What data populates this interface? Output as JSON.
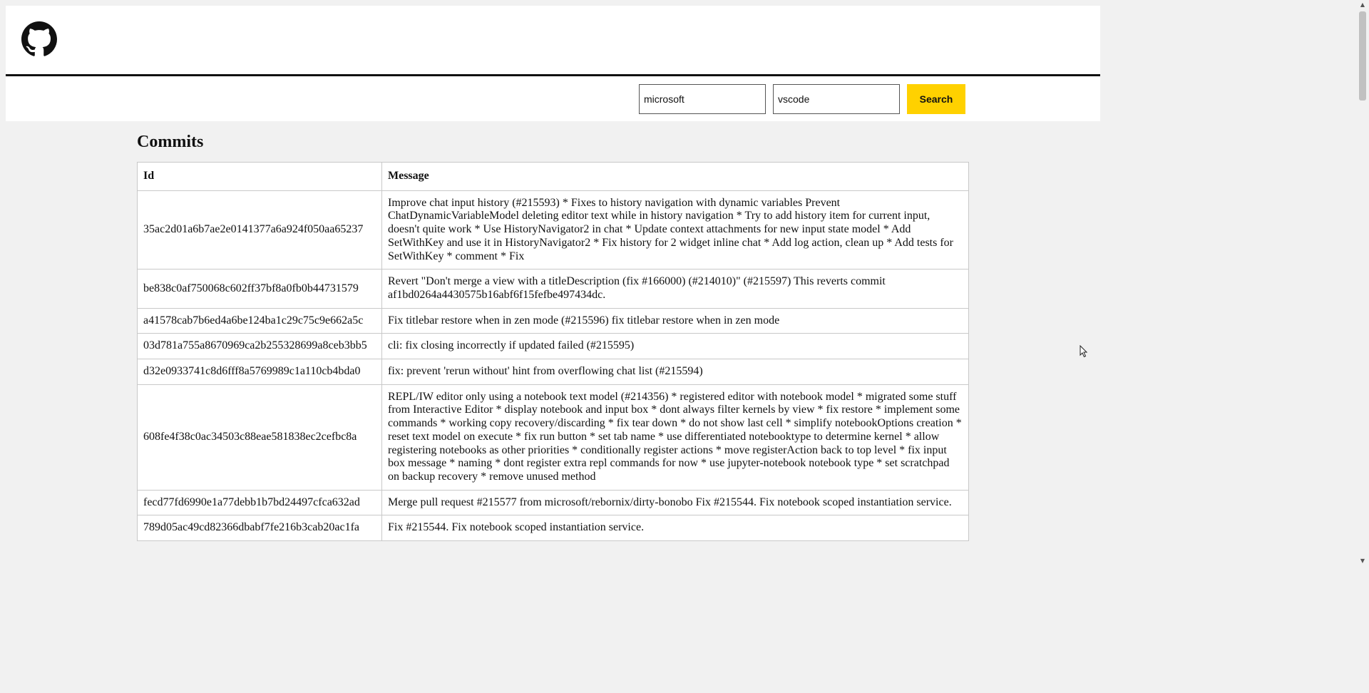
{
  "header": {
    "logo_icon": "github-icon",
    "owner_input": {
      "value": "microsoft"
    },
    "repo_input": {
      "value": "vscode"
    },
    "search_label": "Search",
    "accent_color": "#ffd100"
  },
  "main": {
    "title": "Commits",
    "columns": [
      "Id",
      "Message"
    ],
    "rows": [
      {
        "id": "35ac2d01a6b7ae2e0141377a6a924f050aa65237",
        "message": "Improve chat input history (#215593) * Fixes to history navigation with dynamic variables Prevent ChatDynamicVariableModel deleting editor text while in history navigation * Try to add history item for current input, doesn't quite work * Use HistoryNavigator2 in chat * Update context attachments for new input state model * Add SetWithKey and use it in HistoryNavigator2 * Fix history for 2 widget inline chat * Add log action, clean up * Add tests for SetWithKey * comment * Fix"
      },
      {
        "id": "be838c0af750068c602ff37bf8a0fb0b44731579",
        "message": "Revert \"Don't merge a view with a titleDescription (fix #166000) (#214010)\" (#215597) This reverts commit af1bd0264a4430575b16abf6f15fefbe497434dc."
      },
      {
        "id": "a41578cab7b6ed4a6be124ba1c29c75c9e662a5c",
        "message": "Fix titlebar restore when in zen mode (#215596) fix titlebar restore when in zen mode"
      },
      {
        "id": "03d781a755a8670969ca2b255328699a8ceb3bb5",
        "message": "cli: fix closing incorrectly if updated failed (#215595)"
      },
      {
        "id": "d32e0933741c8d6fff8a5769989c1a110cb4bda0",
        "message": "fix: prevent 'rerun without' hint from overflowing chat list (#215594)"
      },
      {
        "id": "608fe4f38c0ac34503c88eae581838ec2cefbc8a",
        "message": "REPL/IW editor only using a notebook text model (#214356) * registered editor with notebook model * migrated some stuff from Interactive Editor * display notebook and input box * dont always filter kernels by view * fix restore * implement some commands * working copy recovery/discarding * fix tear down * do not show last cell * simplify notebookOptions creation * reset text model on execute * fix run button * set tab name * use differentiated notebooktype to determine kernel * allow registering notebooks as other priorities * conditionally register actions * move registerAction back to top level * fix input box message * naming * dont register extra repl commands for now * use jupyter-notebook notebook type * set scratchpad on backup recovery * remove unused method"
      },
      {
        "id": "fecd77fd6990e1a77debb1b7bd24497cfca632ad",
        "message": "Merge pull request #215577 from microsoft/rebornix/dirty-bonobo Fix #215544. Fix notebook scoped instantiation service."
      },
      {
        "id": "789d05ac49cd82366dbabf7fe216b3cab20ac1fa",
        "message": "Fix #215544. Fix notebook scoped instantiation service."
      }
    ]
  }
}
